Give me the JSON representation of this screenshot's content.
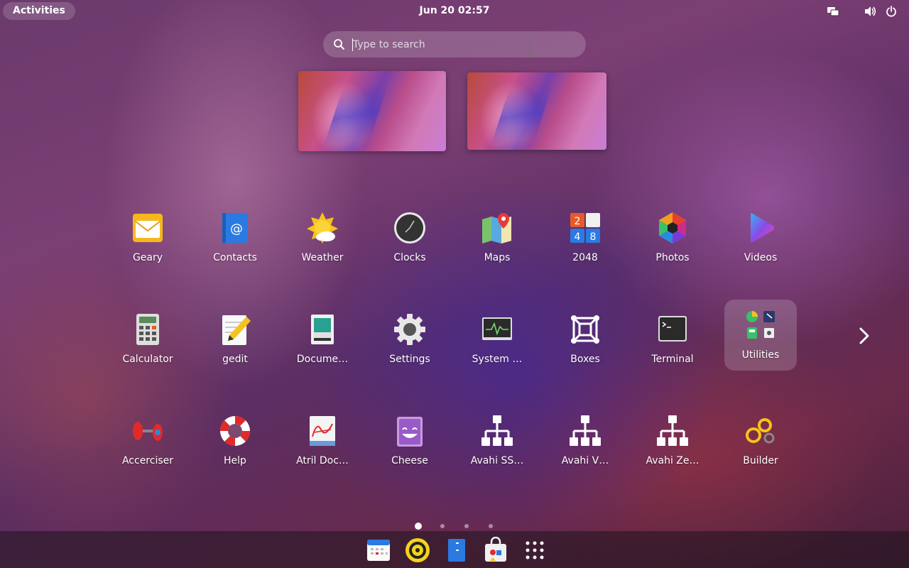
{
  "topbar": {
    "activities_label": "Activities",
    "clock": "Jun 20  02:57",
    "icons": [
      "display-icon",
      "volume-icon",
      "power-icon"
    ]
  },
  "search": {
    "placeholder": "Type to search"
  },
  "workspaces": [
    "workspace-thumbnail",
    "workspace-thumbnail"
  ],
  "apps": [
    {
      "label": "Geary",
      "icon": "mail-icon"
    },
    {
      "label": "Contacts",
      "icon": "address-book-icon"
    },
    {
      "label": "Weather",
      "icon": "sun-cloud-icon"
    },
    {
      "label": "Clocks",
      "icon": "clock-icon"
    },
    {
      "label": "Maps",
      "icon": "map-pin-icon"
    },
    {
      "label": "2048",
      "icon": "number-tiles-icon"
    },
    {
      "label": "Photos",
      "icon": "photos-hexagon-icon"
    },
    {
      "label": "Videos",
      "icon": "play-icon"
    },
    {
      "label": "Calculator",
      "icon": "calculator-icon"
    },
    {
      "label": "gedit",
      "icon": "notepad-pencil-icon"
    },
    {
      "label": "Docume…",
      "icon": "document-viewer-icon"
    },
    {
      "label": "Settings",
      "icon": "gear-icon"
    },
    {
      "label": "System …",
      "icon": "system-monitor-icon"
    },
    {
      "label": "Boxes",
      "icon": "boxes-icon"
    },
    {
      "label": "Terminal",
      "icon": "terminal-icon"
    },
    {
      "label": "Utilities",
      "icon": "app-folder-icon"
    },
    {
      "label": "Accerciser",
      "icon": "dumbbell-icon"
    },
    {
      "label": "Help",
      "icon": "lifebuoy-icon"
    },
    {
      "label": "Atril Doc…",
      "icon": "pdf-document-icon"
    },
    {
      "label": "Cheese",
      "icon": "cheese-face-icon"
    },
    {
      "label": "Avahi SS…",
      "icon": "network-tree-icon"
    },
    {
      "label": "Avahi V…",
      "icon": "network-tree-icon"
    },
    {
      "label": "Avahi Ze…",
      "icon": "network-tree-icon"
    },
    {
      "label": "Builder",
      "icon": "builder-gears-icon"
    }
  ],
  "pager": {
    "pages": 4,
    "current": 1
  },
  "dock": [
    "calendar-icon",
    "rhythmbox-icon",
    "files-icon",
    "software-icon",
    "show-apps-icon"
  ],
  "colors": {
    "selected_tile": "rgba(255,255,255,0.18)",
    "dock_bg": "#2a1c2a"
  }
}
